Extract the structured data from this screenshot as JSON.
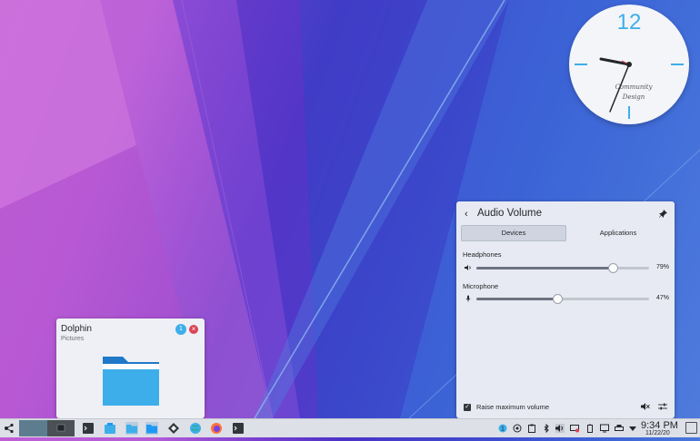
{
  "clock": {
    "twelve": "12",
    "brand_line1": "Community",
    "brand_line2": "Design"
  },
  "dolphin_tooltip": {
    "title": "Dolphin",
    "subtitle": "Pictures",
    "badge": "1",
    "close_glyph": "×",
    "icon": "folder-icon"
  },
  "audio_volume": {
    "back_glyph": "‹",
    "title": "Audio Volume",
    "tabs": [
      {
        "label": "Devices",
        "active": true
      },
      {
        "label": "Applications",
        "active": false
      }
    ],
    "devices": [
      {
        "name": "Headphones",
        "icon": "speaker-icon",
        "volume_percent": 79,
        "volume_label": "79%"
      },
      {
        "name": "Microphone",
        "icon": "microphone-icon",
        "volume_percent": 47,
        "volume_label": "47%"
      }
    ],
    "raise_maximum_volume": {
      "label": "Raise maximum volume",
      "checked": true,
      "check_glyph": "✓"
    }
  },
  "taskbar": {
    "time": "9:34 PM",
    "date": "11/22/20",
    "launchers": [
      "terminal-icon",
      "store-icon",
      "dolphin-icon",
      "files-icon",
      "vault-icon",
      "browser-icon",
      "firefox-icon",
      "console-icon"
    ],
    "tray": [
      "updates-icon",
      "network-icon",
      "clipboard-icon",
      "bluetooth-icon",
      "volume-icon",
      "display-icon",
      "battery-icon",
      "printer-icon",
      "expand-icon"
    ]
  },
  "colors": {
    "accent": "#3daee9",
    "close": "#da4453",
    "panel": "#dde0e7"
  }
}
